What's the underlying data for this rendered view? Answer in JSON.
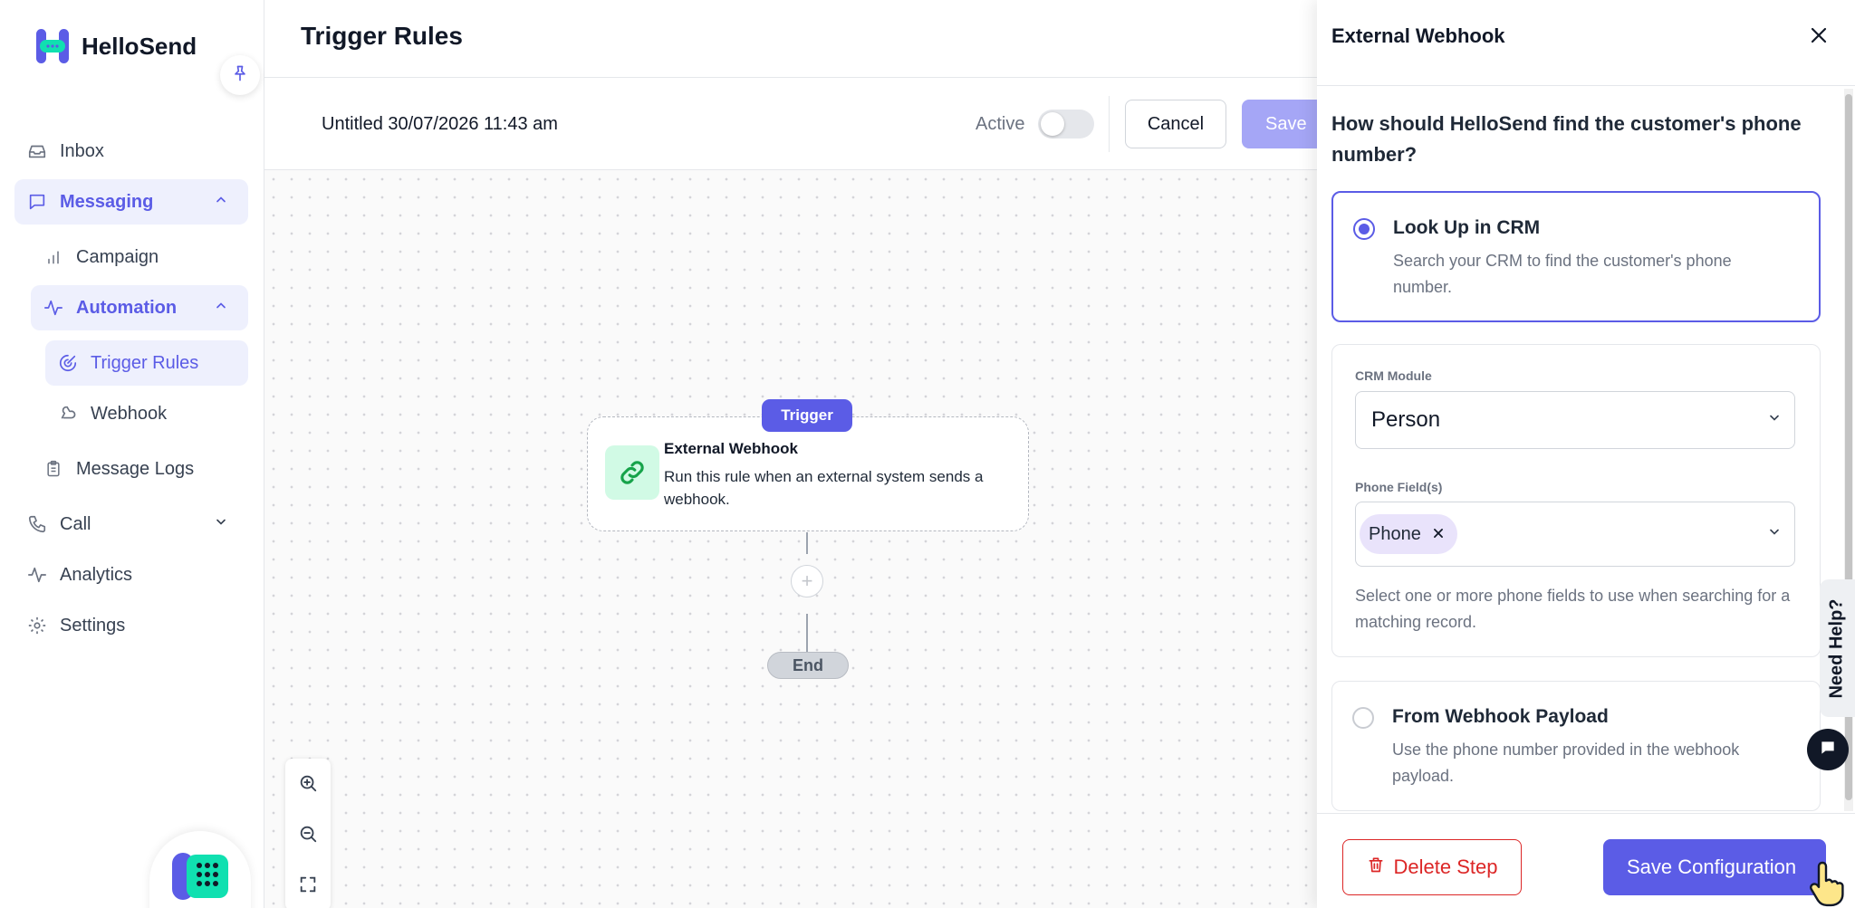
{
  "app": {
    "name": "HelloSend"
  },
  "sidebar": {
    "items": [
      {
        "label": "Inbox",
        "icon": "inbox-icon"
      },
      {
        "label": "Messaging",
        "icon": "chat-icon"
      },
      {
        "label": "Campaign",
        "icon": "bar-chart-icon"
      },
      {
        "label": "Automation",
        "icon": "activity-icon"
      },
      {
        "label": "Trigger Rules",
        "icon": "target-icon"
      },
      {
        "label": "Webhook",
        "icon": "webhook-icon"
      },
      {
        "label": "Message Logs",
        "icon": "clipboard-icon"
      },
      {
        "label": "Call",
        "icon": "phone-icon"
      },
      {
        "label": "Analytics",
        "icon": "activity-icon"
      },
      {
        "label": "Settings",
        "icon": "gear-icon"
      }
    ]
  },
  "header": {
    "title": "Trigger Rules"
  },
  "toolbar": {
    "rule_name": "Untitled 30/07/2026 11:43 am",
    "active_label": "Active",
    "active": false,
    "cancel_label": "Cancel",
    "save_label": "Save"
  },
  "canvas": {
    "trigger_badge": "Trigger",
    "node": {
      "title": "External Webhook",
      "description": "Run this rule when an external system sends a webhook."
    },
    "add_symbol": "+",
    "end_label": "End"
  },
  "panel": {
    "title": "External Webhook",
    "question": "How should HelloSend find the customer's phone number?",
    "options": [
      {
        "title": "Look Up in CRM",
        "description": "Search your CRM to find the customer's phone number.",
        "selected": true
      },
      {
        "title": "From Webhook Payload",
        "description": "Use the phone number provided in the webhook payload.",
        "selected": false
      }
    ],
    "crm": {
      "module_label": "CRM Module",
      "module_value": "Person",
      "phone_label": "Phone Field(s)",
      "phone_chip": "Phone",
      "help_text": "Select one or more phone fields to use when searching for a matching record."
    },
    "need_help": "Need Help?",
    "delete_label": "Delete Step",
    "save_config_label": "Save Configuration"
  },
  "colors": {
    "accent": "#5b5ce6",
    "danger": "#dc2626",
    "brand_green": "#10b981"
  }
}
